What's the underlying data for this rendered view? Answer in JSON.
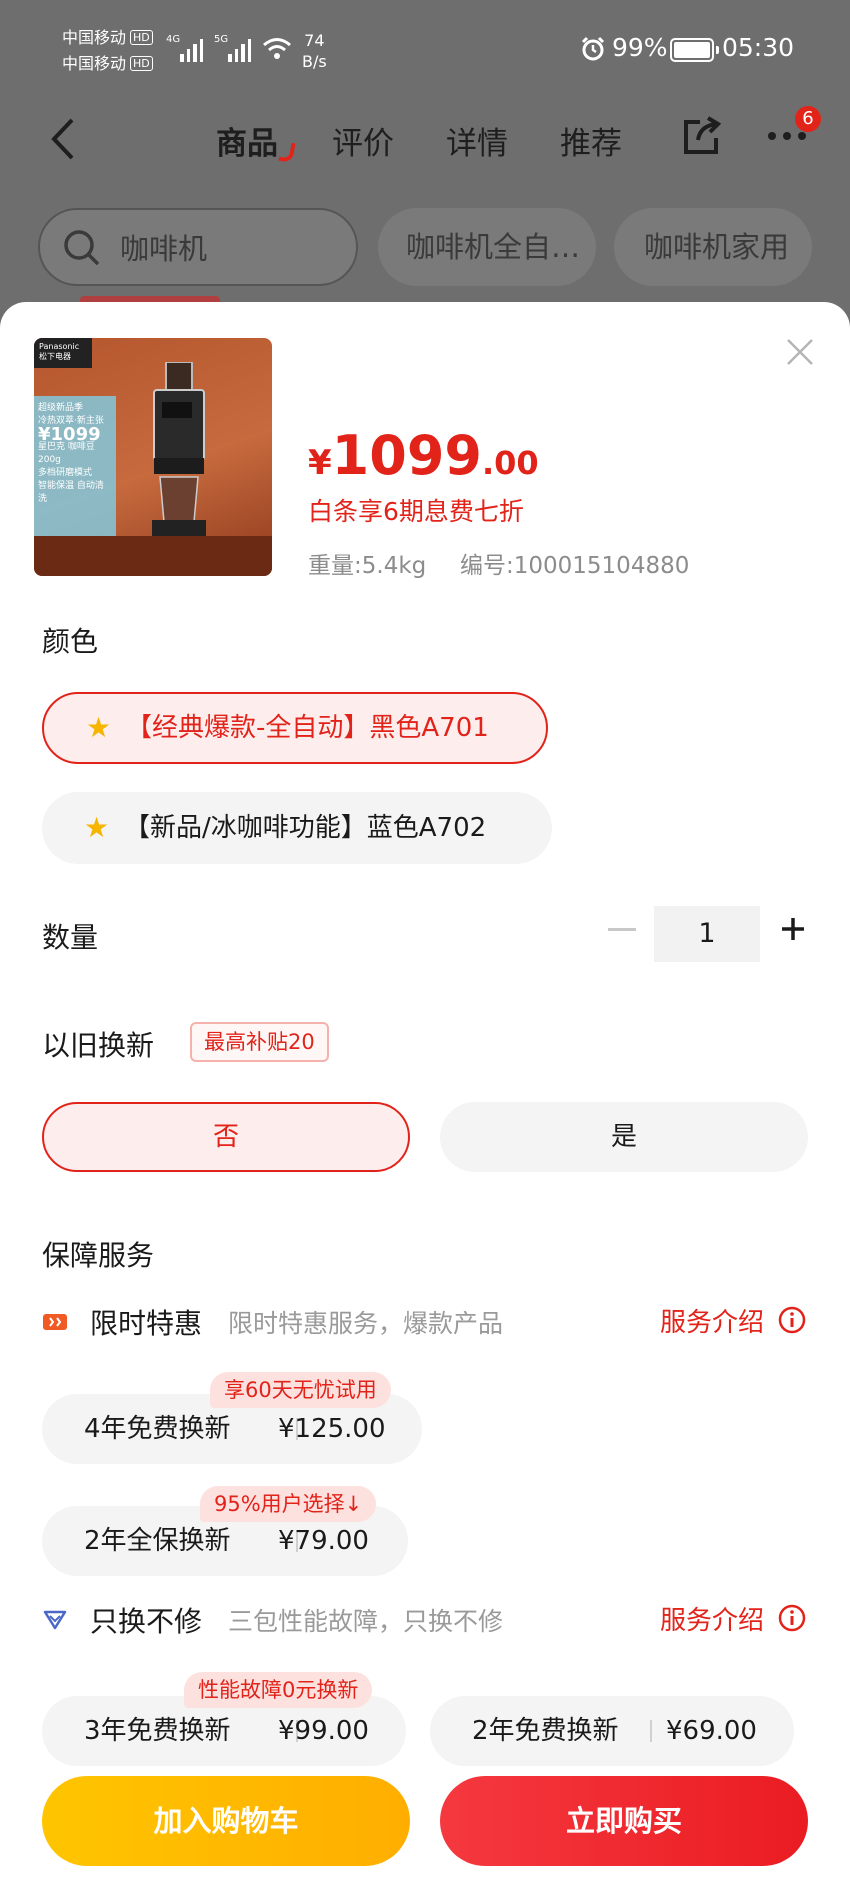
{
  "status_bar": {
    "carrier1": "中国移动",
    "carrier2": "中国移动",
    "hd": "HD",
    "network1": "4G",
    "network2": "5G",
    "speed_value": "74",
    "speed_unit": "B/s",
    "battery": "99%",
    "battery_level": 0.99,
    "time": "05:30"
  },
  "nav": {
    "tabs": [
      {
        "label": "商品",
        "active": true
      },
      {
        "label": "评价"
      },
      {
        "label": "详情"
      },
      {
        "label": "推荐"
      }
    ],
    "more_badge": "6"
  },
  "search": {
    "query": "咖啡机",
    "chips": [
      "咖啡机全自…",
      "咖啡机家用"
    ]
  },
  "product": {
    "thumbnail": {
      "brand": "Panasonic",
      "brand_cn": "松下电器",
      "promo_title": "超级新品季",
      "promo_sub": "冷热双萃·新主张",
      "promo_price": "¥1099",
      "promo_lines": [
        "星巴克 咖啡豆200g",
        "多档研磨模式",
        "智能保温 自动清洗"
      ]
    },
    "price_currency": "¥",
    "price_int": "1099",
    "price_dec": ".00",
    "installment": "白条享6期息费七折",
    "weight": "重量:5.4kg",
    "sku": "编号:100015104880"
  },
  "color": {
    "label": "颜色",
    "options": [
      {
        "label": "【经典爆款-全自动】黑色A701",
        "selected": true
      },
      {
        "label": "【新品/冰咖啡功能】蓝色A702",
        "selected": false
      }
    ]
  },
  "quantity": {
    "label": "数量",
    "value": "1"
  },
  "trade_in": {
    "label": "以旧换新",
    "tag": "最高补贴20",
    "options": [
      {
        "label": "否",
        "selected": true
      },
      {
        "label": "是",
        "selected": false
      }
    ]
  },
  "services": {
    "label": "保障服务",
    "groups": [
      {
        "title": "限时特惠",
        "desc": "限时特惠服务，爆款产品",
        "link": "服务介绍",
        "icon": "gift-icon",
        "options": [
          {
            "name": "4年免费换新",
            "price": "¥125.00",
            "ribbon": "享60天无忧试用"
          },
          {
            "name": "2年全保换新",
            "price": "¥79.00",
            "ribbon": "95%用户选择↓"
          }
        ]
      },
      {
        "title": "只换不修",
        "desc": "三包性能故障，只换不修",
        "link": "服务介绍",
        "icon": "diamond-icon",
        "options": [
          {
            "name": "3年免费换新",
            "price": "¥99.00",
            "ribbon": "性能故障0元换新"
          },
          {
            "name": "2年免费换新",
            "price": "¥69.00"
          }
        ]
      }
    ]
  },
  "actions": {
    "add_to_cart": "加入购物车",
    "buy_now": "立即购买"
  },
  "colors": {
    "accent": "#e2231a",
    "cart": "#ffb800",
    "buy": "#f0262c"
  }
}
